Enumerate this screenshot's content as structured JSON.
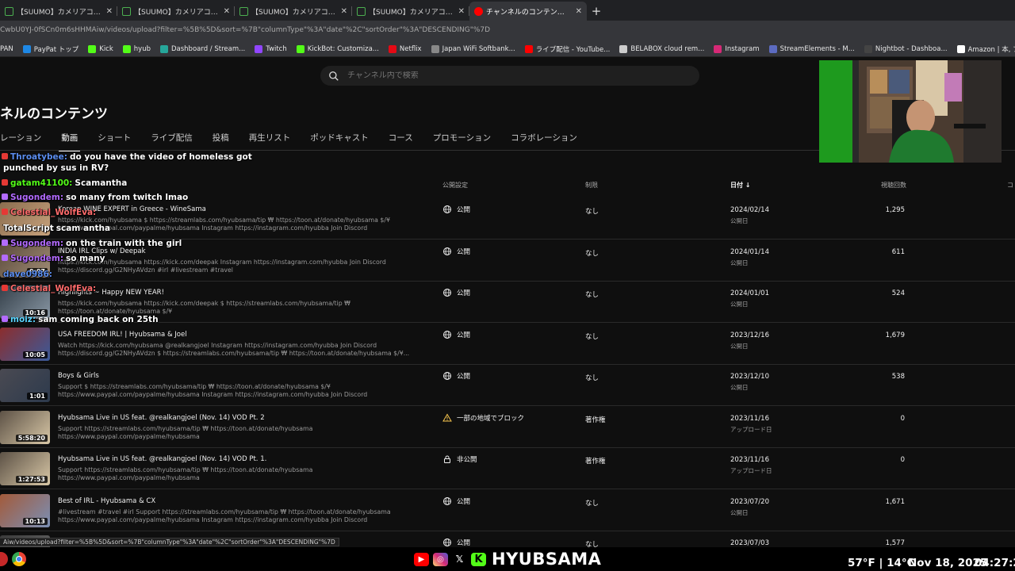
{
  "browser": {
    "tabs": [
      {
        "title": "【SUUMO】カメリアコート新宿（グ",
        "active": false
      },
      {
        "title": "【SUUMO】カメリアコート 新宿（",
        "active": false
      },
      {
        "title": "【SUUMO】カメリアコート 新宿（ソ",
        "active": false
      },
      {
        "title": "【SUUMO】カメリアコート 新宿（",
        "active": false
      },
      {
        "title": "チャンネルのコンテンツ - YouTube S",
        "active": true
      }
    ],
    "url": "CwbU0YJ-0fSCn0m6sHHMAiw/videos/upload?filter=%5B%5D&sort=%7B\"columnType\"%3A\"date\"%2C\"sortOrder\"%3A\"DESCENDING\"%7D",
    "bookmarks": [
      {
        "label": "PAN",
        "color": ""
      },
      {
        "label": "PayPat トップ",
        "color": "#1e88e5"
      },
      {
        "label": "Kick",
        "color": "#53fc18"
      },
      {
        "label": "hyub",
        "color": "#53fc18"
      },
      {
        "label": "Dashboard / Stream...",
        "color": "#26a69a"
      },
      {
        "label": "Twitch",
        "color": "#9146ff"
      },
      {
        "label": "KickBot: Customiza...",
        "color": "#53fc18"
      },
      {
        "label": "Netflix",
        "color": "#e50914"
      },
      {
        "label": "Japan WiFi Softbank...",
        "color": "#888888"
      },
      {
        "label": "ライブ配信 - YouTube...",
        "color": "#ff0000"
      },
      {
        "label": "BELABOX cloud rem...",
        "color": "#cccccc"
      },
      {
        "label": "Instagram",
        "color": "#d62976"
      },
      {
        "label": "StreamElements - M...",
        "color": "#5c6bc0"
      },
      {
        "label": "Nightbot - Dashboa...",
        "color": "#444444"
      },
      {
        "label": "Amazon | 本, ファッシ...",
        "color": "#ffffff"
      },
      {
        "label": "YouTube Studio",
        "color": "#ff0000"
      },
      {
        "label": "仕事",
        "color": "#aaaaaa"
      },
      {
        "label": "kickchat",
        "color": "#53fc18"
      },
      {
        "label": "The I",
        "color": "#ffffff"
      }
    ]
  },
  "studio": {
    "search_placeholder": "チャンネル内で検索",
    "page_title": "ネルのコンテンツ",
    "tabs": [
      "レーション",
      "動画",
      "ショート",
      "ライブ配信",
      "投稿",
      "再生リスト",
      "ポッドキャスト",
      "コース",
      "プロモーション",
      "コラボレーション"
    ],
    "columns": {
      "visibility": "公開設定",
      "restrictions": "制限",
      "date": "日付",
      "views": "視聴回数",
      "comments": "コ"
    },
    "rows": [
      {
        "title": "Korean WINE EXPERT in Greece - WineSama",
        "desc": "https://kick.com/hyubsama $ https://streamlabs.com/hyubsama/tip ₩ https://toon.at/donate/hyubsama $/¥\nhttps://www.paypal.com/paypalme/hyubsama Instagram https://instagram.com/hyubba Join Discord https://discord.gg/G2NHyAVdzn",
        "duration": "",
        "visibility": "公開",
        "vis_icon": "globe",
        "restriction": "なし",
        "date": "2024/02/14",
        "date_status": "公開日",
        "views": "1,295"
      },
      {
        "title": "INDIA IRL Clips w/ Deepak",
        "desc": "https://kick.com/hyubsama https://kick.com/deepak Instagram https://instagram.com/hyubba Join Discord\nhttps://discord.gg/G2NHyAVdzn #irl #livestream #travel",
        "duration": "9:07",
        "visibility": "公開",
        "vis_icon": "globe",
        "restriction": "なし",
        "date": "2024/01/14",
        "date_status": "公開日",
        "views": "611"
      },
      {
        "title": "Highlights ~ Happy NEW YEAR!",
        "desc": "https://kick.com/hyubsama https://kick.com/deepak $ https://streamlabs.com/hyubsama/tip ₩ https://toon.at/donate/hyubsama $/¥\nhttps://www.paypal.com/paypalme/hyubsama Instagram https://instagram.com/hyubba Join Discord https://discord.gg/G2NHyAVdzn",
        "duration": "10:16",
        "visibility": "公開",
        "vis_icon": "globe",
        "restriction": "なし",
        "date": "2024/01/01",
        "date_status": "公開日",
        "views": "524"
      },
      {
        "title": "USA FREEDOM IRL! | Hyubsama & Joel",
        "desc": "Watch https://kick.com/hyubsama @realkangjoel Instagram https://instagram.com/hyubba Join Discord\nhttps://discord.gg/G2NHyAVdzn $ https://streamlabs.com/hyubsama/tip ₩ https://toon.at/donate/hyubsama $/¥...",
        "duration": "10:05",
        "visibility": "公開",
        "vis_icon": "globe",
        "restriction": "なし",
        "date": "2023/12/16",
        "date_status": "公開日",
        "views": "1,679"
      },
      {
        "title": "Boys & Girls",
        "desc": "Support $ https://streamlabs.com/hyubsama/tip ₩ https://toon.at/donate/hyubsama $/¥\nhttps://www.paypal.com/paypalme/hyubsama Instagram https://instagram.com/hyubba Join Discord https://discord.gg/G2NHyAVdzn",
        "duration": "1:01",
        "visibility": "公開",
        "vis_icon": "globe",
        "restriction": "なし",
        "date": "2023/12/10",
        "date_status": "公開日",
        "views": "538"
      },
      {
        "title": "Hyubsama Live in US feat. @realkangjoel (Nov. 14) VOD Pt. 2",
        "desc": "Support https://streamlabs.com/hyubsama/tip ₩ https://toon.at/donate/hyubsama https://www.paypal.com/paypalme/hyubsama\nInstagram https://instagram.com/hyubba Join Discord https://discord.gg/G2NHyAVdzn Watch https://kick.com/hyubsama...",
        "duration": "5:58:20",
        "visibility": "一部の地域でブロック",
        "vis_icon": "warning",
        "restriction": "著作権",
        "date": "2023/11/16",
        "date_status": "アップロード日",
        "views": "0"
      },
      {
        "title": "Hyubsama Live in US feat. @realkangjoel (Nov. 14) VOD Pt. 1.",
        "desc": "Support https://streamlabs.com/hyubsama/tip ₩ https://toon.at/donate/hyubsama https://www.paypal.com/paypalme/hyubsama\nInstagram https://instagram.com/hyubba Join Discord https://discord.gg/G2NHyAVdzn Watch https://kick.com/hyub...",
        "duration": "1:27:53",
        "visibility": "非公開",
        "vis_icon": "lock",
        "restriction": "著作権",
        "date": "2023/11/16",
        "date_status": "アップロード日",
        "views": "0"
      },
      {
        "title": "Best of IRL - Hyubsama & CX",
        "desc": "#livestream #travel #irl Support https://streamlabs.com/hyubsama/tip ₩ https://toon.at/donate/hyubsama\nhttps://www.paypal.com/paypalme/hyubsama Instagram https://instagram.com/hyubba Join Discord https://discord.gg/G2NHyAVdzn",
        "duration": "10:13",
        "visibility": "公開",
        "vis_icon": "globe",
        "restriction": "なし",
        "date": "2023/07/20",
        "date_status": "公開日",
        "views": "1,671"
      },
      {
        "title": "",
        "desc": "",
        "duration": "",
        "visibility": "公開",
        "vis_icon": "globe",
        "restriction": "なし",
        "date": "2023/07/03",
        "date_status": "",
        "views": "1,577"
      }
    ]
  },
  "chat": [
    {
      "user": "Throatybee:",
      "user_color": "#5b8def",
      "msg": "do you have the video of homeless got",
      "badge": "#e53935"
    },
    {
      "user": "",
      "user_color": "#ffffff",
      "msg": "punched by sus in RV?",
      "badge": ""
    },
    {
      "user": "gatam41100:",
      "user_color": "#53fc18",
      "msg": "Scamantha",
      "badge": "#e53935"
    },
    {
      "user": "Sugondem:",
      "user_color": "#b36bff",
      "msg": "so many from twitch lmao",
      "badge": "#b36bff"
    },
    {
      "user": "Celestial_WolfEva:",
      "user_color": "#ff6b6b",
      "msg": "",
      "badge": "#e53935"
    },
    {
      "user": "TotalScript",
      "user_color": "#ffffff",
      "msg": "scam antha",
      "badge": ""
    },
    {
      "user": "Sugondem:",
      "user_color": "#b36bff",
      "msg": "on the train with the girl",
      "badge": "#b36bff"
    },
    {
      "user": "Sugondem:",
      "user_color": "#b36bff",
      "msg": "so many",
      "badge": "#b36bff"
    },
    {
      "user": "dave0986:",
      "user_color": "#5b8def",
      "msg": "",
      "badge": ""
    },
    {
      "user": "Celestial_WolfEva:",
      "user_color": "#ff6b6b",
      "msg": "",
      "badge": "#e53935"
    },
    {
      "user": "moiz:",
      "user_color": "#5bd6ff",
      "msg": "sam coming back on 25th",
      "badge": "#b36bff"
    }
  ],
  "status_url": "Aiw/videos/upload?filter=%5B%5D&sort=%7B\"columnType\"%3A\"date\"%2C\"sortOrder\"%3A\"DESCENDING\"%7D",
  "overlay": {
    "brand": "HYUBSAMA",
    "weather": "57°F | 14°C",
    "date": "Nov 18, 2025",
    "time": "04:27:22"
  }
}
